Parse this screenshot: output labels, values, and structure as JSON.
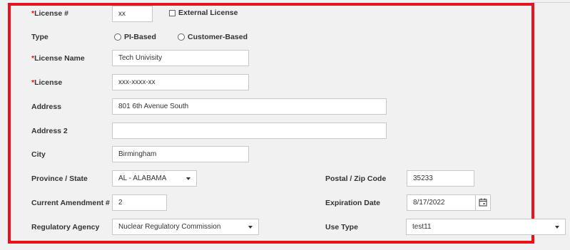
{
  "license_number": {
    "required_mark": "*",
    "label": "License #",
    "value": "xx"
  },
  "external_license": {
    "label": "External License",
    "checked": false
  },
  "type": {
    "label": "Type",
    "options": [
      {
        "label": "PI-Based",
        "selected": false
      },
      {
        "label": "Customer-Based",
        "selected": false
      }
    ]
  },
  "license_name": {
    "required_mark": "*",
    "label": "License Name",
    "value": "Tech Univisity"
  },
  "license": {
    "required_mark": "*",
    "label": "License",
    "value": "xxx-xxxx-xx"
  },
  "address": {
    "label": "Address",
    "value": "801 6th Avenue South"
  },
  "address2": {
    "label": "Address 2",
    "value": ""
  },
  "city": {
    "label": "City",
    "value": "Birmingham"
  },
  "province_state": {
    "label": "Province / State",
    "value": "AL - ALABAMA"
  },
  "postal_zip": {
    "label": "Postal / Zip Code",
    "value": "35233"
  },
  "current_amendment": {
    "label": "Current Amendment #",
    "value": "2"
  },
  "expiration_date": {
    "label": "Expiration Date",
    "value": "8/17/2022",
    "icon": "calendar-icon"
  },
  "regulatory_agency": {
    "label": "Regulatory Agency",
    "value": "Nuclear Regulatory Commission"
  },
  "use_type": {
    "label": "Use Type",
    "value": "test11"
  },
  "colors": {
    "highlight_border": "#e8141b",
    "required_mark": "#e8141b",
    "background": "#f1f1f1"
  }
}
